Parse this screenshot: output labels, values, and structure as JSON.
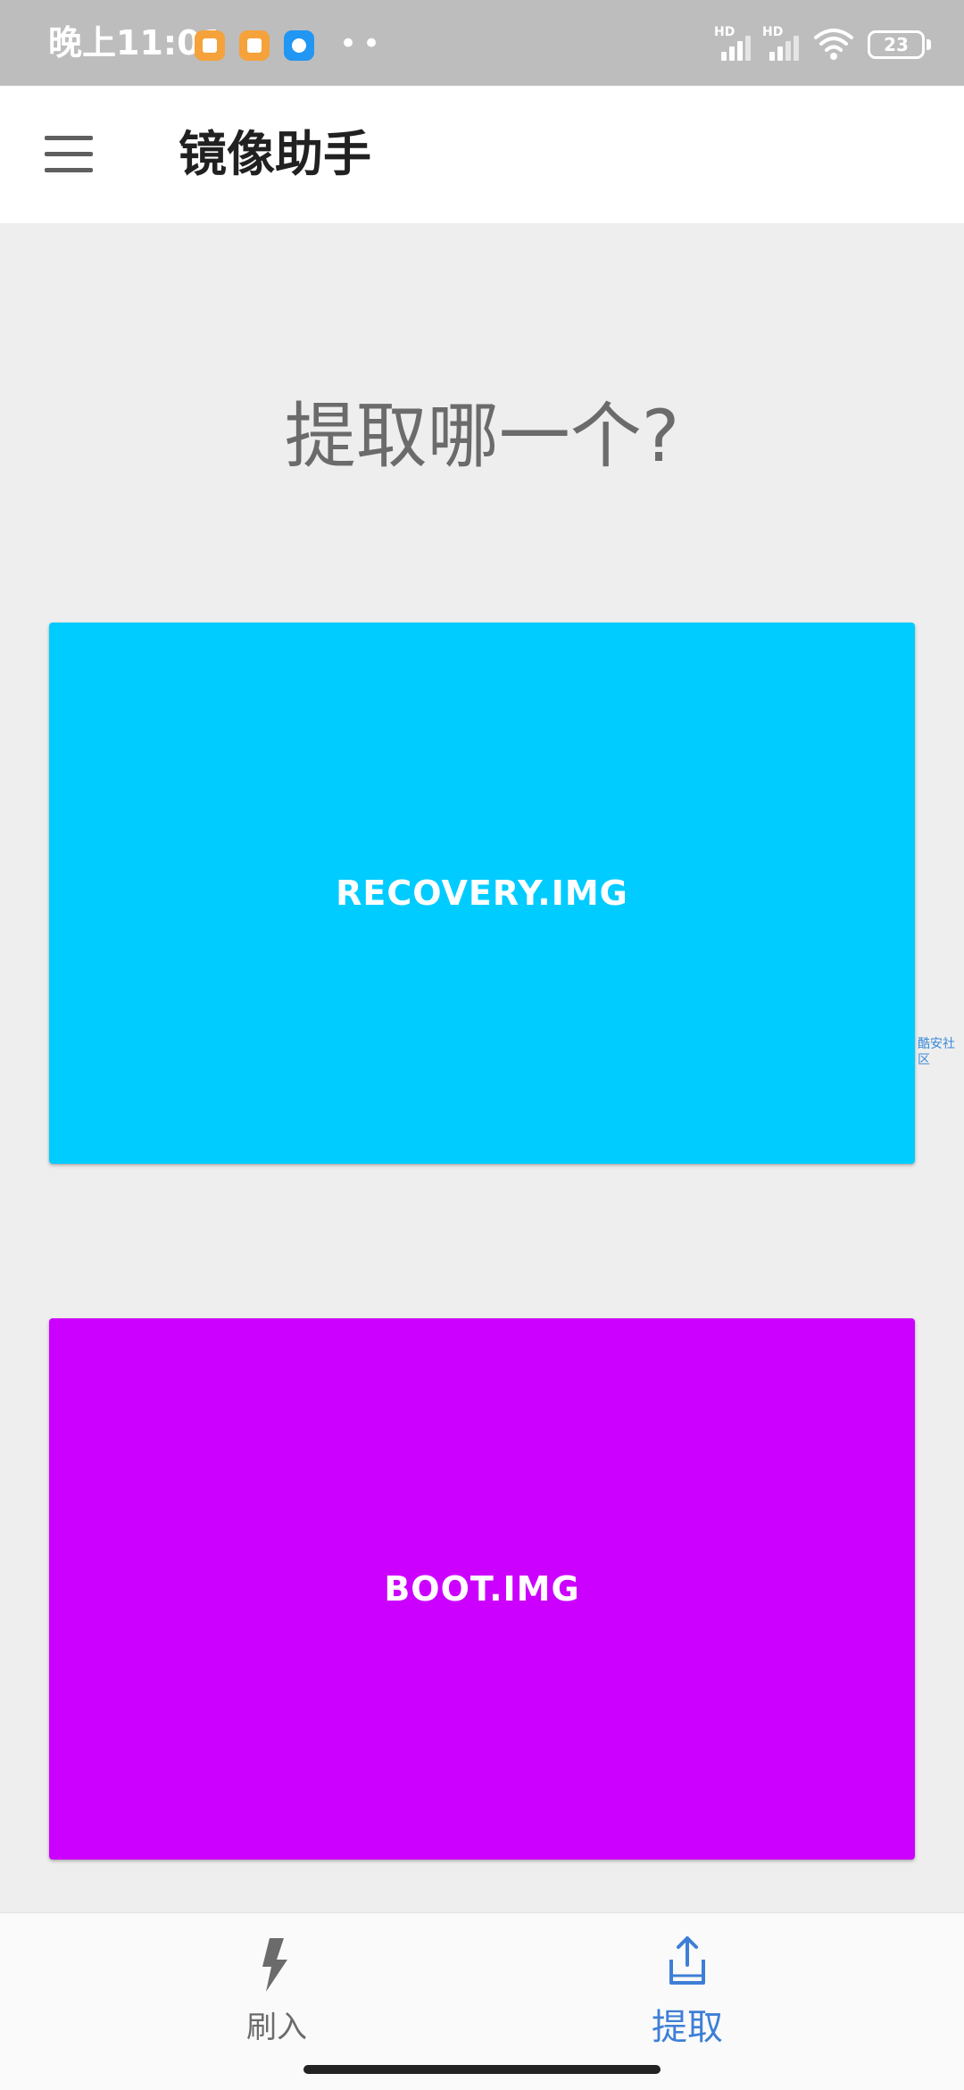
{
  "status_bar": {
    "time": "晚上11:01",
    "notification_dots": "••",
    "signal_label": "HD",
    "battery_level": "23",
    "notification_icon_colors": [
      "#f5a23a",
      "#f5a23a",
      "#2196f3"
    ]
  },
  "app_bar": {
    "menu_icon": "hamburger-menu-icon",
    "title": "镜像助手"
  },
  "main": {
    "prompt": "提取哪一个?",
    "options": [
      {
        "label": "RECOVERY.IMG",
        "color": "#00ccff"
      },
      {
        "label": "BOOT.IMG",
        "color": "#cc00ff"
      }
    ],
    "watermark": "酷安社区"
  },
  "bottom_nav": {
    "items": [
      {
        "label": "刷入",
        "icon": "lightning-bolt-icon",
        "active": false,
        "color": "#6b6b6b"
      },
      {
        "label": "提取",
        "icon": "upload-tray-icon",
        "active": true,
        "color": "#3e7fd6"
      }
    ]
  }
}
